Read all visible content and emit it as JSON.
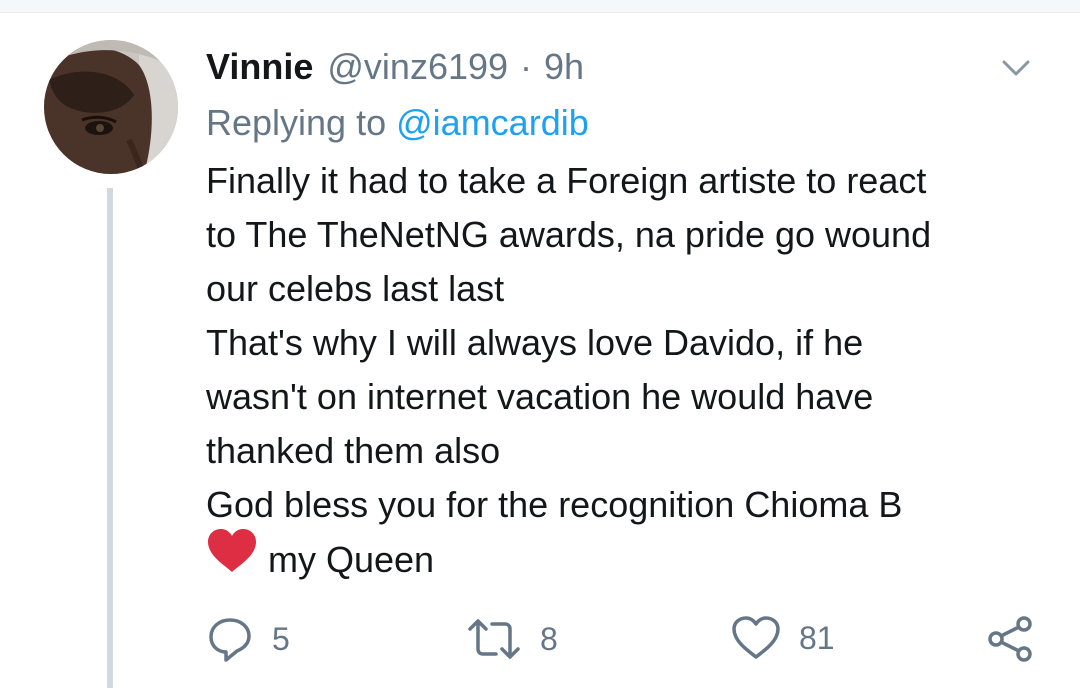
{
  "tweet": {
    "author_name": "Vinnie",
    "author_handle": "@vinz6199",
    "separator": "·",
    "time": "9h",
    "reply_prefix": "Replying to",
    "reply_mention": "@iamcardib",
    "text_lines": [
      "Finally it had to take a Foreign artiste to react",
      "to The TheNetNG awards, na pride go wound",
      "our celebs last last",
      "That's why I will always love Davido, if he",
      "wasn't on internet vacation he would have",
      "thanked them also",
      "God bless you for the recognition Chioma B"
    ],
    "last_line_text": "my Queen",
    "emoji": "red-heart"
  },
  "actions": {
    "reply_count": "5",
    "retweet_count": "8",
    "like_count": "81"
  },
  "icons": {
    "caret": "chevron-down-icon",
    "reply": "reply-icon",
    "retweet": "retweet-icon",
    "like": "heart-icon",
    "share": "share-icon"
  },
  "colors": {
    "text": "#14171a",
    "muted": "#657786",
    "mention": "#1da1f2",
    "heart_emoji": "#dd2e44",
    "thread_line": "#cfd9de"
  }
}
